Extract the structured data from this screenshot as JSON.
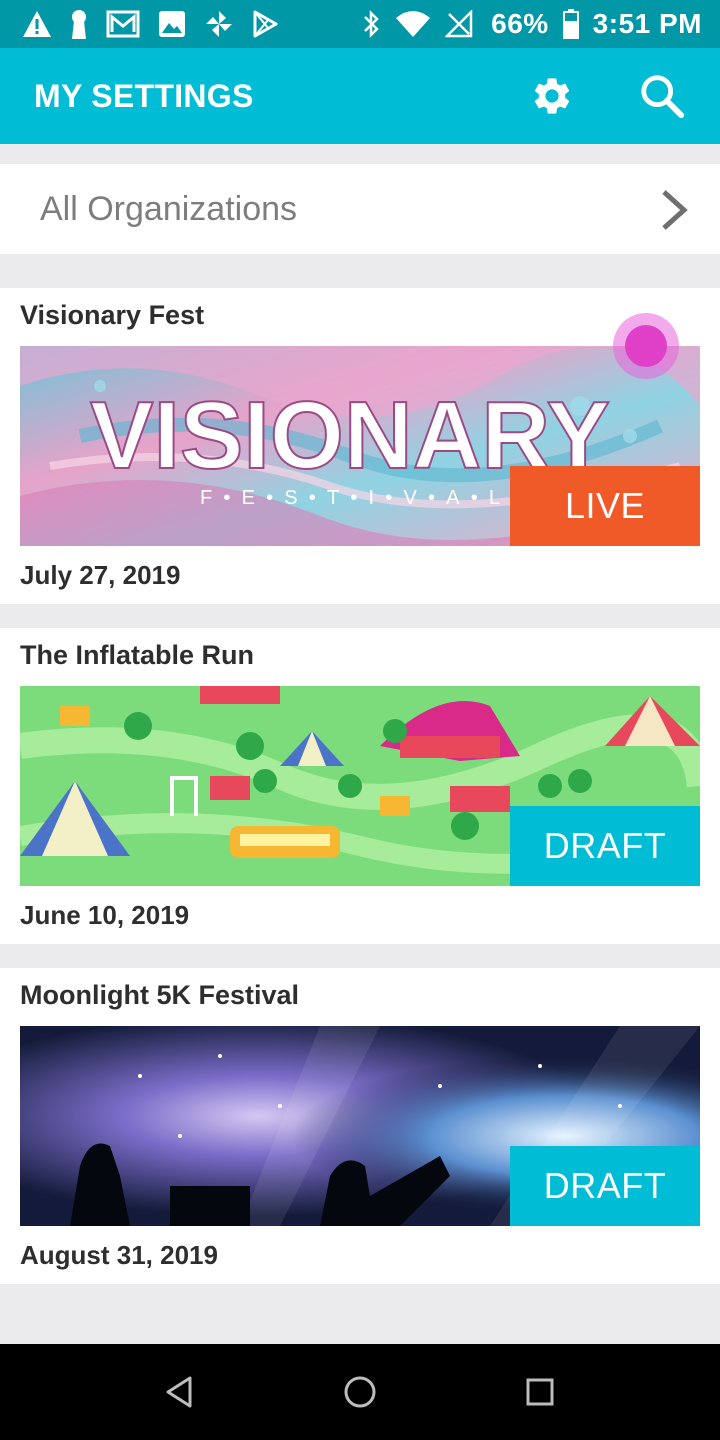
{
  "status_bar": {
    "left_icons": [
      "warning-icon",
      "keyhole-icon",
      "gmail-icon",
      "image-icon",
      "pinwheel-icon",
      "play-store-icon"
    ],
    "right_icons": [
      "bluetooth-icon",
      "wifi-icon",
      "no-signal-icon",
      "battery-icon"
    ],
    "battery": "66%",
    "time": "3:51 PM"
  },
  "app_bar": {
    "title": "MY SETTINGS",
    "actions": [
      "gear-icon",
      "search-icon"
    ],
    "color": "#00bcd4"
  },
  "org_selector": {
    "label": "All Organizations",
    "icon": "chevron-right-icon"
  },
  "events": [
    {
      "title": "Visionary Fest",
      "banner_text": "VISIONARY",
      "banner_subtext": "F•E•S•T•I•V•A•L",
      "status": "LIVE",
      "status_color": "#f05a28",
      "date": "July 27, 2019"
    },
    {
      "title": "The Inflatable Run",
      "status": "DRAFT",
      "status_color": "#00bcd4",
      "date": "June 10, 2019"
    },
    {
      "title": "Moonlight 5K Festival",
      "status": "DRAFT",
      "status_color": "#00bcd4",
      "date": "August 31, 2019"
    }
  ],
  "nav_bar": {
    "buttons": [
      "back-icon",
      "home-icon",
      "recents-icon"
    ]
  }
}
